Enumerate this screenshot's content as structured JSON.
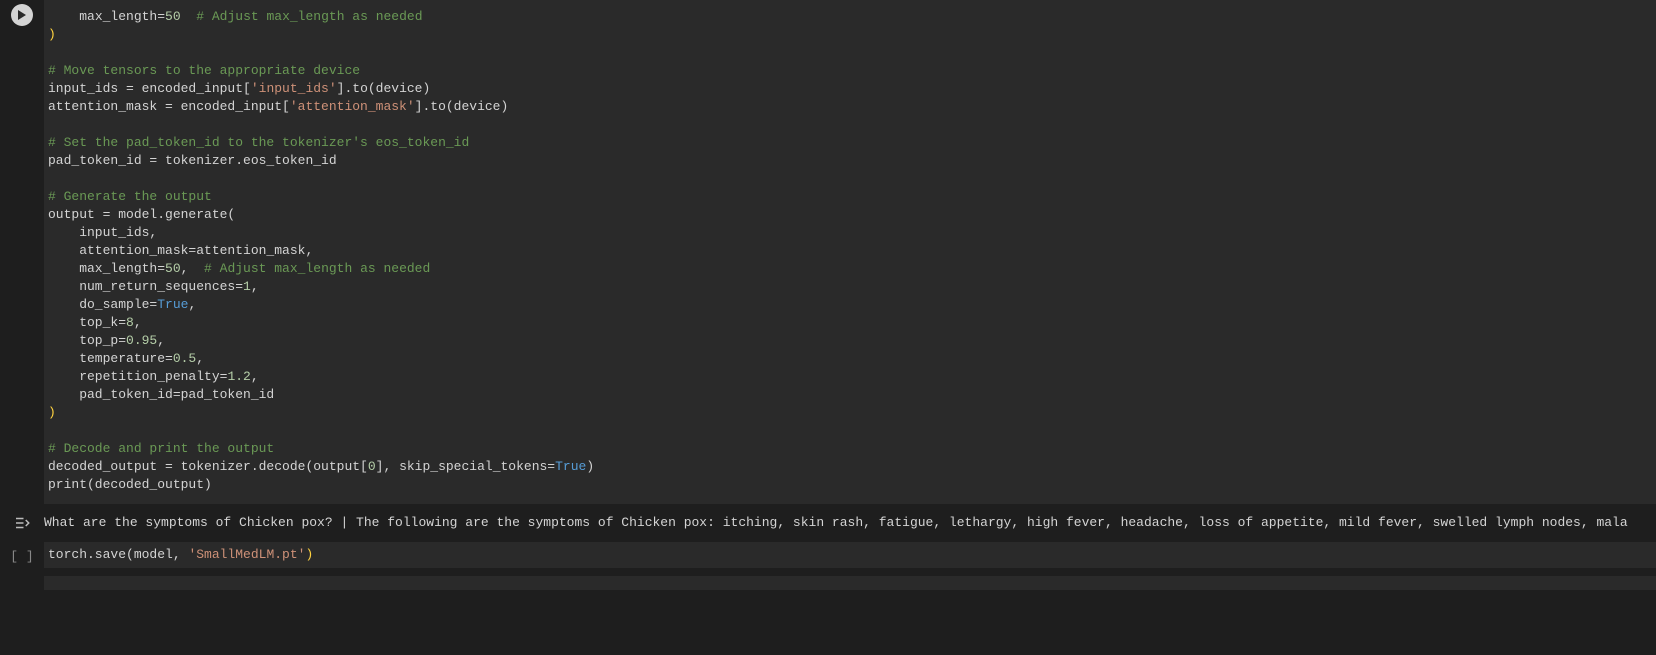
{
  "cells": {
    "main_code": {
      "line1_indent": "    ",
      "line1_kw": "max_length",
      "line1_eq": "=",
      "line1_num": "50",
      "line1_sp": "  ",
      "line1_cm": "# Adjust max_length as needed",
      "line2": ")",
      "line3": "",
      "line4_cm": "# Move tensors to the appropriate device",
      "line5_a": "input_ids = encoded_input[",
      "line5_str": "'input_ids'",
      "line5_b": "].to(device)",
      "line6_a": "attention_mask = encoded_input[",
      "line6_str": "'attention_mask'",
      "line6_b": "].to(device)",
      "line7": "",
      "line8_cm": "# Set the pad_token_id to the tokenizer's eos_token_id",
      "line9": "pad_token_id = tokenizer.eos_token_id",
      "line10": "",
      "line11_cm": "# Generate the output",
      "line12": "output = model.generate(",
      "line13": "    input_ids,",
      "line14": "    attention_mask=attention_mask,",
      "line15_a": "    max_length=",
      "line15_num": "50",
      "line15_b": ",  ",
      "line15_cm": "# Adjust max_length as needed",
      "line16_a": "    num_return_sequences=",
      "line16_num": "1",
      "line16_b": ",",
      "line17_a": "    do_sample=",
      "line17_kw": "True",
      "line17_b": ",",
      "line18_a": "    top_k=",
      "line18_num": "8",
      "line18_b": ",",
      "line19_a": "    top_p=",
      "line19_num": "0.95",
      "line19_b": ",",
      "line20_a": "    temperature=",
      "line20_num": "0.5",
      "line20_b": ",",
      "line21_a": "    repetition_penalty=",
      "line21_num": "1.2",
      "line21_b": ",",
      "line22": "    pad_token_id=pad_token_id",
      "line23": ")",
      "line24": "",
      "line25_cm": "# Decode and print the output",
      "line26_a": "decoded_output = tokenizer.decode(output[",
      "line26_num": "0",
      "line26_b": "], skip_special_tokens=",
      "line26_kw": "True",
      "line26_c": ")",
      "line27": "print(decoded_output)"
    },
    "output_text": "What are the symptoms of Chicken pox? | The following are the symptoms of Chicken pox: itching, skin rash, fatigue, lethargy, high fever, headache, loss of appetite, mild fever, swelled lymph nodes, mala",
    "save_code": {
      "a": "torch.save(model, ",
      "str": "'SmallMedLM.pt'",
      "b": ")"
    },
    "bracket_empty": "[ ]"
  }
}
